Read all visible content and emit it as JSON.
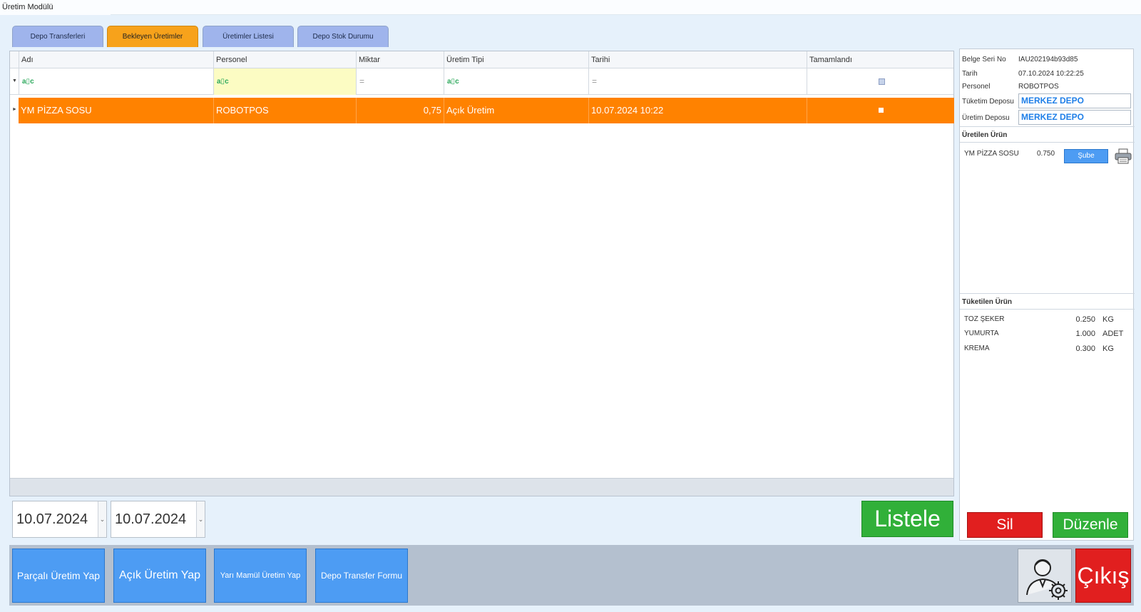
{
  "window": {
    "title": "Üretim Modülü"
  },
  "tabs": [
    {
      "label": "Depo Transferleri",
      "active": false
    },
    {
      "label": "Bekleyen Üretimler",
      "active": true
    },
    {
      "label": "Üretimler Listesi",
      "active": false
    },
    {
      "label": "Depo Stok Durumu",
      "active": false
    }
  ],
  "grid": {
    "columns": [
      "Adı",
      "Personel",
      "Miktar",
      "Üretim Tipi",
      "Tarihi",
      "Tamamlandı"
    ],
    "filter_symbols": {
      "contains": "a▯c",
      "equals": "="
    },
    "rows": [
      {
        "adi": "YM PİZZA SOSU",
        "personel": "ROBOTPOS",
        "miktar": "0,75",
        "uretim_tipi": "Açık Üretim",
        "tarihi": "10.07.2024 10:22"
      }
    ]
  },
  "date_range": {
    "start": "10.07.2024",
    "end": "10.07.2024"
  },
  "buttons": {
    "listele": "Listele",
    "parcali": "Parçalı Üretim Yap",
    "acik": "Açık Üretim Yap",
    "yari_mamul": "Yarı Mamül Üretim Yap",
    "depo_transfer": "Depo Transfer Formu",
    "sil": "Sil",
    "duzenle": "Düzenle",
    "cikis": "Çıkış",
    "sube": "Şube"
  },
  "detail": {
    "labels": {
      "belge_seri_no": "Belge Seri No",
      "tarih": "Tarih",
      "personel": "Personel",
      "tuketim_deposu": "Tüketim Deposu",
      "uretim_deposu": "Üretim Deposu"
    },
    "values": {
      "belge_seri_no": "IAU202194b93d85",
      "tarih": "07.10.2024 10:22:25",
      "personel": "ROBOTPOS",
      "tuketim_deposu": "MERKEZ DEPO",
      "uretim_deposu": "MERKEZ DEPO"
    },
    "uretilen_title": "Üretilen Ürün",
    "uretilen": {
      "name": "YM PİZZA SOSU",
      "qty": "0.750"
    },
    "tuketilen_title": "Tüketilen Ürün",
    "tuketilen": [
      {
        "name": "TOZ ŞEKER",
        "qty": "0.250",
        "unit": "KG"
      },
      {
        "name": "YUMURTA",
        "qty": "1.000",
        "unit": "ADET"
      },
      {
        "name": "KREMA",
        "qty": "0.300",
        "unit": "KG"
      }
    ]
  },
  "colors": {
    "selected_row": "#ff8200",
    "active_tab": "#f7a21b",
    "tab": "#9fb4ec",
    "action_blue": "#4d9cf3",
    "green": "#31b039",
    "red": "#e11f1f",
    "depo_text": "#1f7fe8"
  }
}
